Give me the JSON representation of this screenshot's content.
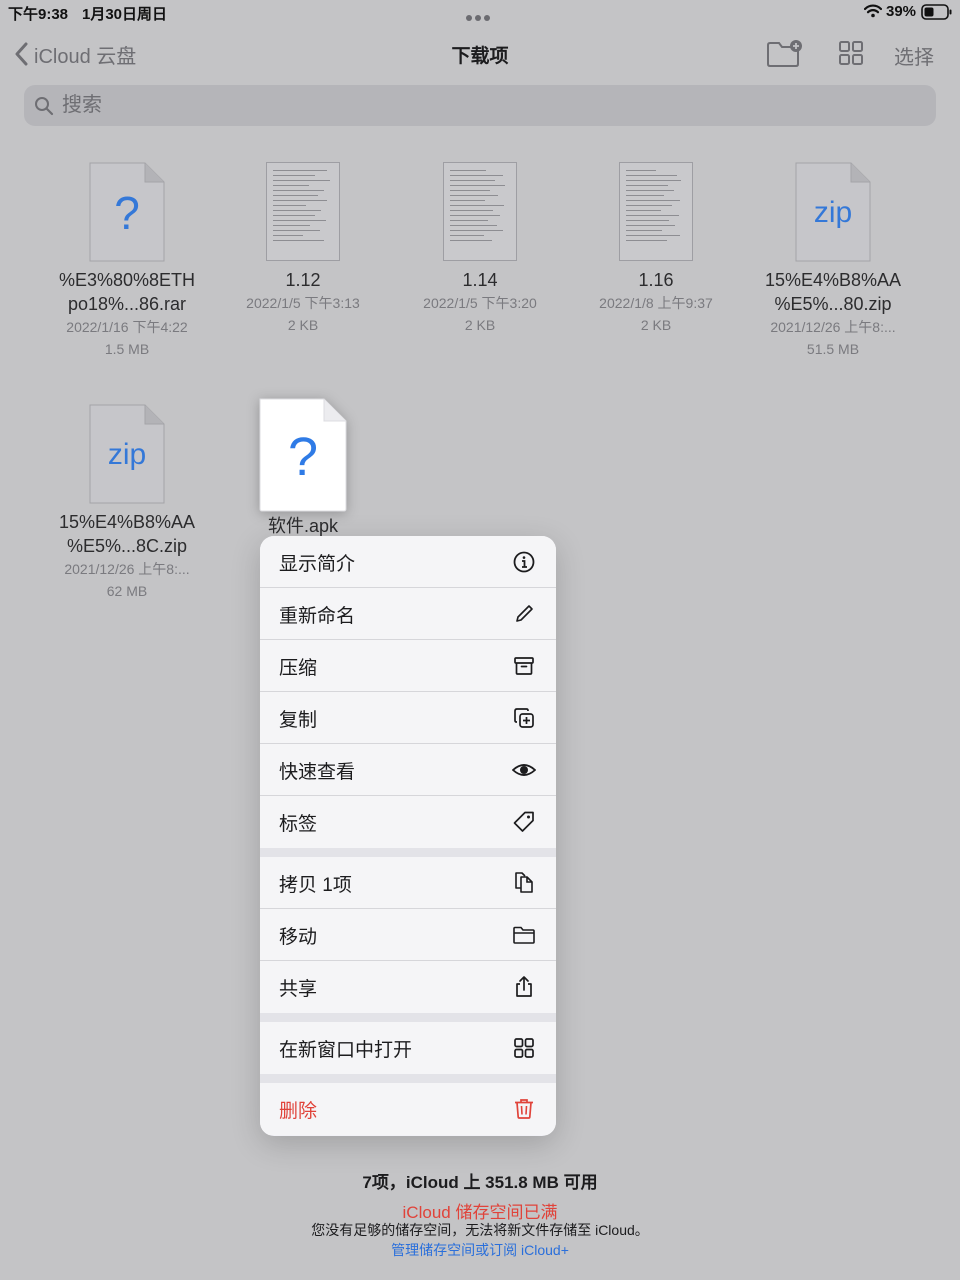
{
  "status_bar": {
    "time": "下午9:38",
    "date": "1月30日周日",
    "battery": "39%"
  },
  "nav": {
    "back_label": "iCloud 云盘",
    "title": "下载项",
    "select_label": "选择"
  },
  "search": {
    "placeholder": "搜索"
  },
  "files": [
    {
      "name_line1": "%E3%80%8ETH",
      "name_line2": "po18%...86.rar",
      "date": "2022/1/16 下午4:22",
      "size": "1.5 MB",
      "icon": "question-file"
    },
    {
      "name_line1": "1.12",
      "date": "2022/1/5 下午3:13",
      "size": "2 KB",
      "icon": "document-thumbnail"
    },
    {
      "name_line1": "1.14",
      "date": "2022/1/5 下午3:20",
      "size": "2 KB",
      "icon": "document-thumbnail"
    },
    {
      "name_line1": "1.16",
      "date": "2022/1/8 上午9:37",
      "size": "2 KB",
      "icon": "document-thumbnail"
    },
    {
      "name_line1": "15%E4%B8%AA",
      "name_line2": "%E5%...80.zip",
      "date": "2021/12/26 上午8:...",
      "size": "51.5 MB",
      "icon": "zip-file",
      "icon_text": "zip"
    },
    {
      "name_line1": "15%E4%B8%AA",
      "name_line2": "%E5%...8C.zip",
      "date": "2021/12/26 上午8:...",
      "size": "62 MB",
      "icon": "zip-file",
      "icon_text": "zip"
    }
  ],
  "selected_file": {
    "name": "软件.apk",
    "icon": "question-file"
  },
  "context_menu": {
    "items": [
      {
        "label": "显示简介",
        "icon": "info-icon"
      },
      {
        "label": "重新命名",
        "icon": "pencil-icon"
      },
      {
        "label": "压缩",
        "icon": "archive-box-icon"
      },
      {
        "label": "复制",
        "icon": "duplicate-icon"
      },
      {
        "label": "快速查看",
        "icon": "eye-icon"
      },
      {
        "label": "标签",
        "icon": "tag-icon"
      },
      {
        "label": "拷贝 1项",
        "icon": "copy-docs-icon"
      },
      {
        "label": "移动",
        "icon": "folder-icon"
      },
      {
        "label": "共享",
        "icon": "share-icon"
      },
      {
        "label": "在新窗口中打开",
        "icon": "grid-window-icon"
      },
      {
        "label": "删除",
        "icon": "trash-icon"
      }
    ]
  },
  "footer": {
    "count": "7项，iCloud 上 351.8 MB 可用",
    "warning": "iCloud 储存空间已满",
    "description": "您没有足够的储存空间，无法将新文件存储至 iCloud。",
    "link": "管理储存空间或订阅 iCloud+"
  },
  "colors": {
    "accent_blue": "#2a6fdb",
    "danger_red": "#e0433a",
    "dim_background": "#c4c4c6"
  }
}
